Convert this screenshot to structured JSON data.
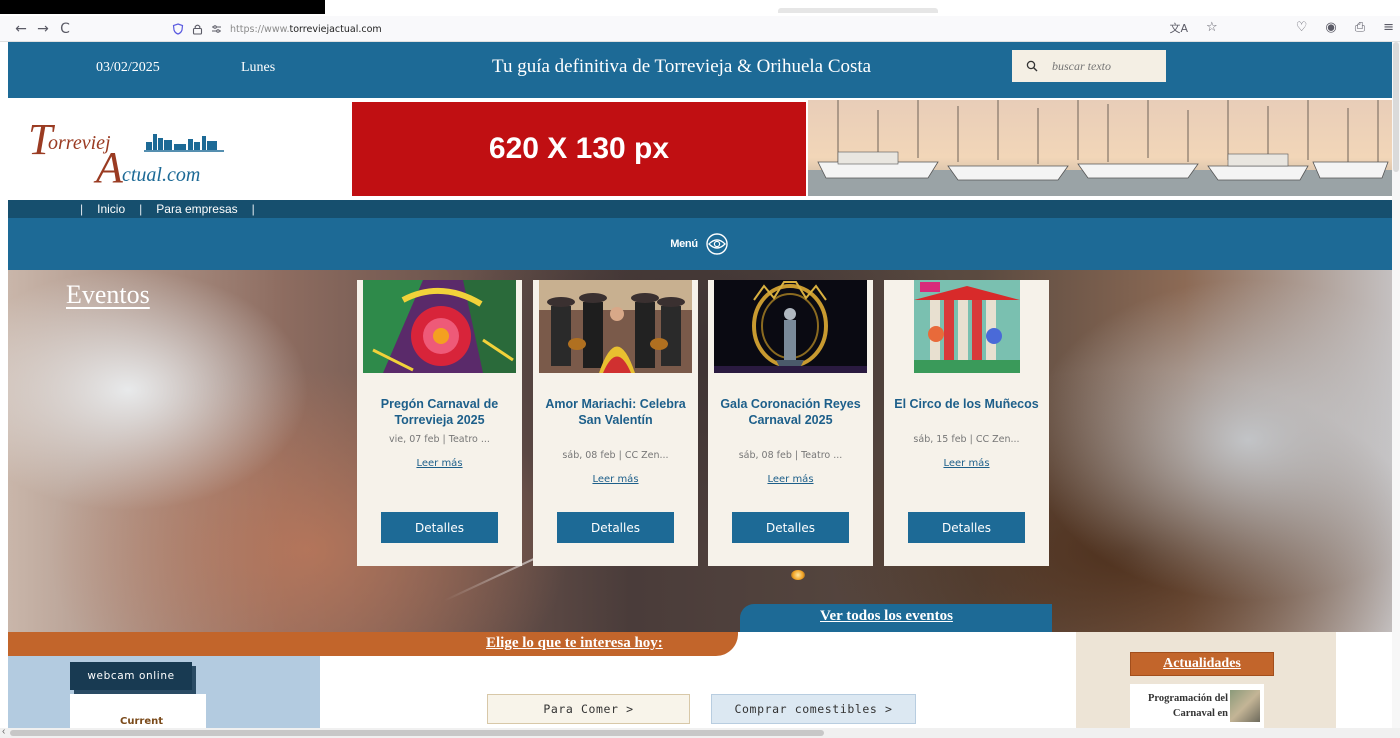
{
  "browser": {
    "url_prefix": "https://www.",
    "url_domain": "torreviejactual.com",
    "back": "←",
    "forward": "→",
    "reload": "C",
    "right_icons": [
      "translate-icon",
      "star-icon",
      "pocket-icon",
      "account-icon",
      "extensions-icon",
      "menu-icon"
    ]
  },
  "header": {
    "date": "03/02/2025",
    "day": "Lunes",
    "tagline": "Tu guía definitiva de Torrevieja & Orihuela Costa",
    "search_placeholder": "buscar texto"
  },
  "logo": {
    "part1": "T",
    "part2": "orreviej",
    "part3": "A",
    "part4": "ctual.com"
  },
  "ad_banner": "620 X 130 px",
  "nav": {
    "items": [
      "Inicio",
      "Para empresas"
    ],
    "menu_label": "Menú"
  },
  "events": {
    "section_title": "Eventos",
    "cards": [
      {
        "title": "Pregón Carnaval de Torrevieja 2025",
        "meta": "vie, 07 feb  |  Teatro ...",
        "more": "Leer más",
        "button": "Detalles"
      },
      {
        "title": "Amor Mariachi: Celebra San Valentín",
        "meta": "sáb, 08 feb  |  CC Zen...",
        "more": "Leer más",
        "button": "Detalles"
      },
      {
        "title": "Gala Coronación Reyes Carnaval 2025",
        "meta": "sáb, 08 feb  |  Teatro ...",
        "more": "Leer más",
        "button": "Detalles"
      },
      {
        "title": "El Circo de los Muñecos",
        "meta": "sáb, 15 feb  |  CC Zen...",
        "more": "Leer más",
        "button": "Detalles"
      }
    ],
    "see_all": "Ver todos los eventos"
  },
  "interests": {
    "title": "Elige lo que te interesa hoy:",
    "webcam": "webcam online",
    "current": "Current",
    "pills": [
      "Para Comer >",
      "Comprar comestibles >"
    ]
  },
  "sidebar": {
    "title": "Actualidades",
    "news": "Programación del Carnaval en"
  },
  "colors": {
    "primary_blue": "#1d6a96",
    "dark_blue": "#164f6e",
    "orange": "#c2652b",
    "ad_red": "#c00f12",
    "logo_brown": "#9a3b22"
  }
}
